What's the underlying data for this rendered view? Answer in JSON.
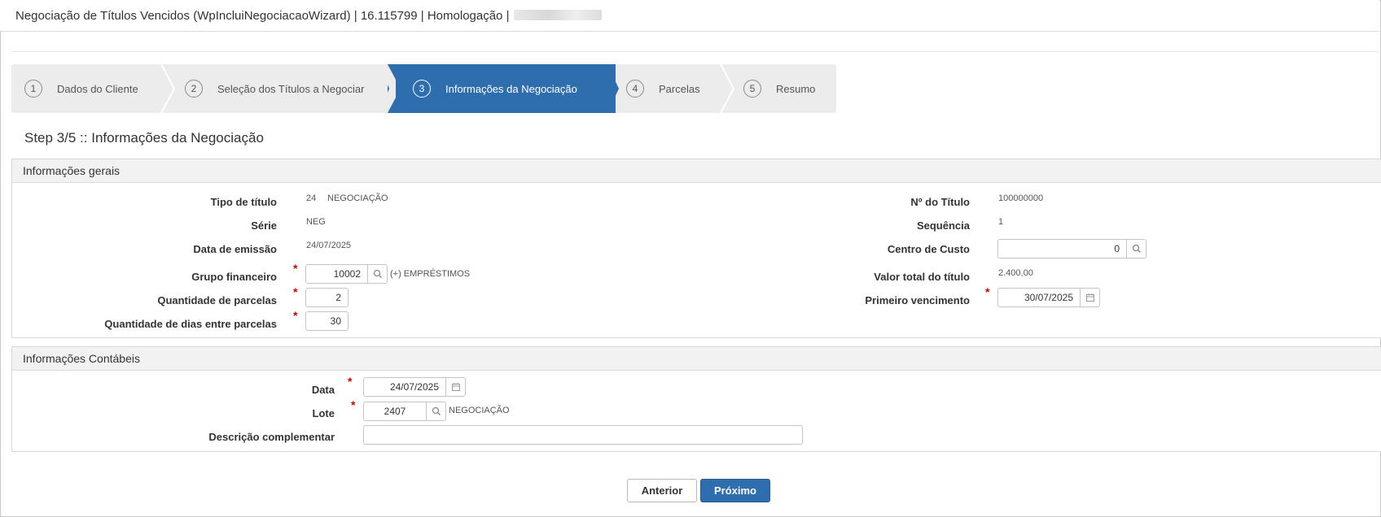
{
  "window": {
    "title": "Negociação de Títulos Vencidos (WpIncluiNegociacaoWizard) | 16.115799 | Homologação |"
  },
  "wizard": {
    "steps": [
      {
        "num": "1",
        "label": "Dados do Cliente"
      },
      {
        "num": "2",
        "label": "Seleção dos Títulos a Negociar"
      },
      {
        "num": "3",
        "label": "Informações da Negociação"
      },
      {
        "num": "4",
        "label": "Parcelas"
      },
      {
        "num": "5",
        "label": "Resumo"
      }
    ],
    "active_step": 3
  },
  "page": {
    "title": "Step 3/5 :: Informações da Negociação"
  },
  "geral": {
    "header": "Informações gerais",
    "tipo_titulo": {
      "label": "Tipo de título",
      "code": "24",
      "text": "NEGOCIAÇÃO"
    },
    "serie": {
      "label": "Série",
      "value": "NEG"
    },
    "data_emissao": {
      "label": "Data de emissão",
      "value": "24/07/2025"
    },
    "grupo_financeiro": {
      "label": "Grupo financeiro",
      "value": "10002",
      "desc": "(+) EMPRÉSTIMOS"
    },
    "qtd_parcelas": {
      "label": "Quantidade de parcelas",
      "value": "2"
    },
    "qtd_dias": {
      "label": "Quantidade de dias entre parcelas",
      "value": "30"
    },
    "num_titulo": {
      "label": "Nº do Título",
      "value": "100000000"
    },
    "sequencia": {
      "label": "Sequência",
      "value": "1"
    },
    "centro_custo": {
      "label": "Centro de Custo",
      "value": "0"
    },
    "valor_total": {
      "label": "Valor total do título",
      "value": "2.400,00"
    },
    "primeiro_venc": {
      "label": "Primeiro vencimento",
      "value": "30/07/2025"
    }
  },
  "contabeis": {
    "header": "Informações Contábeis",
    "data": {
      "label": "Data",
      "value": "24/07/2025"
    },
    "lote": {
      "label": "Lote",
      "value": "2407",
      "desc": "NEGOCIAÇÃO"
    },
    "descricao": {
      "label": "Descrição complementar",
      "value": ""
    }
  },
  "actions": {
    "prev_label": "Anterior",
    "next_label": "Próximo"
  },
  "colors": {
    "accent": "#2f6eae",
    "required": "#d20000"
  }
}
